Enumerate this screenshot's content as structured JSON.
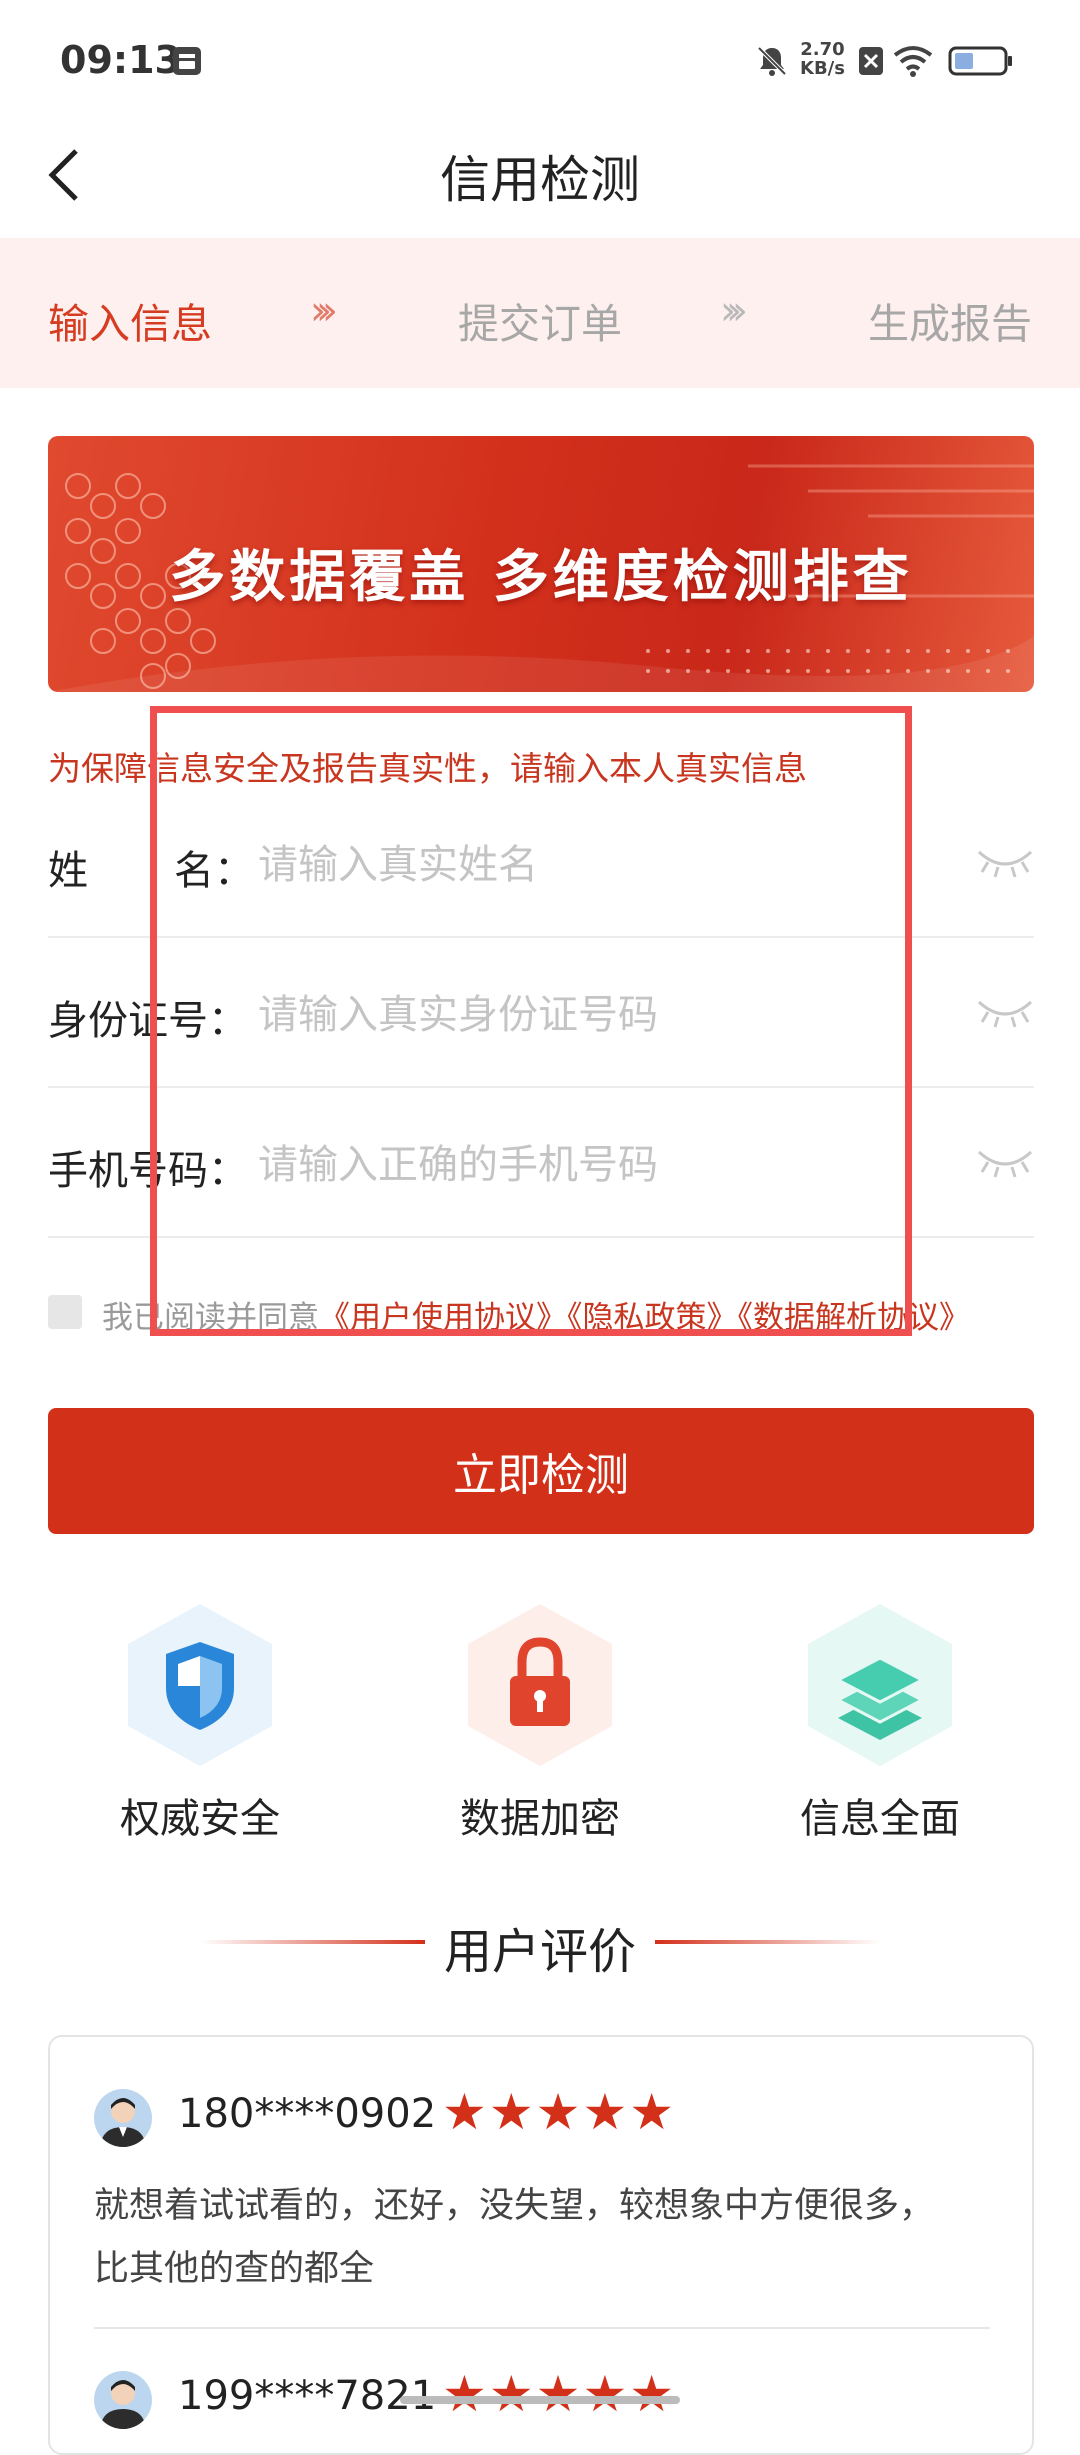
{
  "status_bar": {
    "time": "09:13",
    "net_speed_value": "2.70",
    "net_speed_unit": "KB/s"
  },
  "header": {
    "title": "信用检测"
  },
  "steps": [
    {
      "label": "输入信息",
      "active": true
    },
    {
      "label": "提交订单",
      "active": false
    },
    {
      "label": "生成报告",
      "active": false
    }
  ],
  "step_arrow": "›››",
  "banner": {
    "text": "多数据覆盖  多维度检测排查"
  },
  "notice": "为保障信息安全及报告真实性，请输入本人真实信息",
  "form": {
    "name": {
      "label": "姓",
      "label_end": "名：",
      "placeholder": "请输入真实姓名"
    },
    "id": {
      "label": "身份证号：",
      "placeholder": "请输入真实身份证号码"
    },
    "phone": {
      "label": "手机号码：",
      "placeholder": "请输入正确的手机号码"
    }
  },
  "agreement": {
    "prefix": "我已阅读并同意",
    "links": [
      "《用户使用协议》",
      "《隐私政策》",
      "《数据解析协议》"
    ]
  },
  "submit_label": "立即检测",
  "features": [
    {
      "label": "权威安全",
      "icon": "shield-icon"
    },
    {
      "label": "数据加密",
      "icon": "lock-icon"
    },
    {
      "label": "信息全面",
      "icon": "layers-icon"
    }
  ],
  "reviews": {
    "title": "用户评价",
    "items": [
      {
        "user": "180****0902",
        "rating": 5,
        "text_line1": "就想着试试看的，还好，没失望，较想象中方便很多，",
        "text_line2": "比其他的查的都全"
      },
      {
        "user": "199****7821",
        "rating": 5
      }
    ]
  },
  "colors": {
    "accent": "#d3301a",
    "step_bg": "#fdf0ee",
    "highlight_box": "#ef4f4f"
  }
}
